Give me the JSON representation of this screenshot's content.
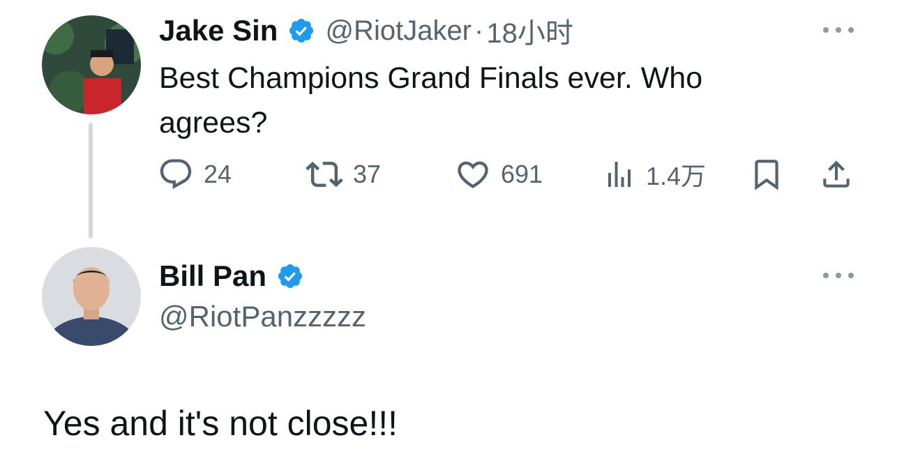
{
  "parent_tweet": {
    "author": {
      "display_name": "Jake Sin",
      "handle": "@RiotJaker",
      "verified": true
    },
    "separator": "·",
    "time": "18小时",
    "text": "Best Champions Grand Finals ever. Who agrees?",
    "actions": {
      "replies": "24",
      "retweets": "37",
      "likes": "691",
      "views": "1.4万"
    }
  },
  "reply_tweet": {
    "author": {
      "display_name": "Bill Pan",
      "handle": "@RiotPanzzzzz",
      "verified": true
    },
    "text": "Yes and it's not close!!!"
  },
  "colors": {
    "text_primary": "#0f1419",
    "text_secondary": "#536471",
    "verified_blue": "#1d9bf0",
    "thread_line": "#cfd9de"
  },
  "icons": [
    "verified-badge-icon",
    "more-options-icon",
    "reply-icon",
    "retweet-icon",
    "like-icon",
    "views-icon",
    "bookmark-icon",
    "share-icon"
  ]
}
